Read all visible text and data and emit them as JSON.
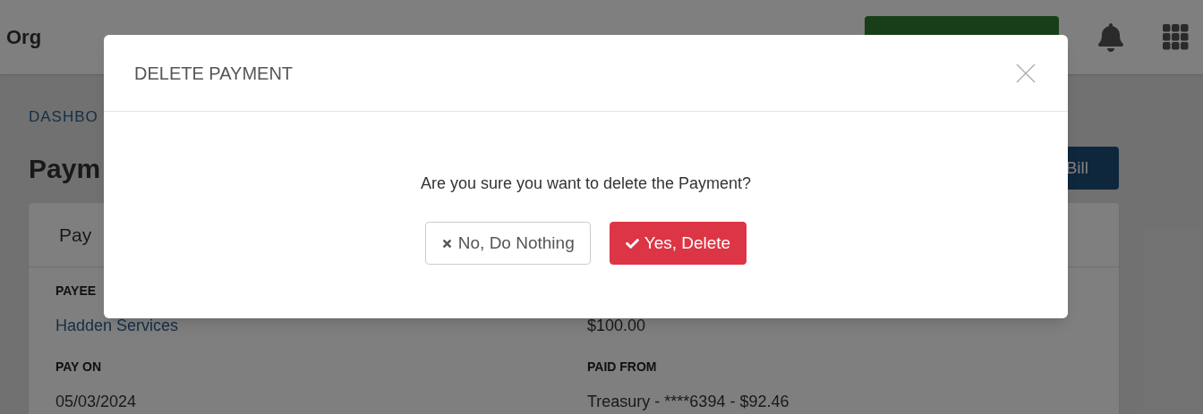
{
  "header": {
    "org": "Org"
  },
  "breadcrumb": "DASHBO",
  "page_title": "Paym",
  "bill_button": "Bill",
  "card": {
    "title": "Pay",
    "left_fields": [
      {
        "label": "PAYEE",
        "value": "Hadden Services",
        "kind": "link"
      },
      {
        "label": "PAY ON",
        "value": "05/03/2024",
        "kind": "text"
      }
    ],
    "right_fields": [
      {
        "value": "$100.00",
        "kind": "text"
      },
      {
        "label": "PAID FROM",
        "value": "Treasury - ****6394 - $92.46",
        "kind": "text"
      }
    ]
  },
  "modal": {
    "title": "DELETE PAYMENT",
    "message": "Are you sure you want to delete the Payment?",
    "buttons": [
      {
        "label": "No, Do Nothing",
        "kind": "cancel"
      },
      {
        "label": "Yes, Delete",
        "kind": "danger"
      }
    ]
  }
}
